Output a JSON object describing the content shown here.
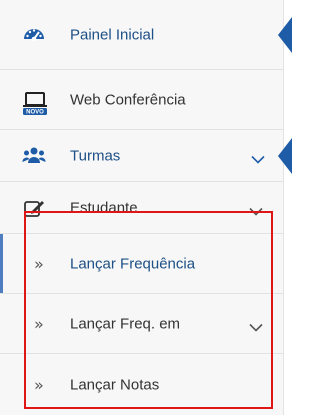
{
  "menu": {
    "painel": {
      "label": "Painel Inicial",
      "icon": "dashboard-icon"
    },
    "web": {
      "label": "Web Conferência",
      "badge": "NOVO",
      "icon": "laptop-icon"
    },
    "turmas": {
      "label": "Turmas",
      "icon": "users-icon"
    },
    "estudante": {
      "label": "Estudante",
      "icon": "edit-icon"
    },
    "lancar_frequencia": {
      "label": "Lançar Frequência",
      "icon": "double-chevron-icon"
    },
    "lancar_freq_em": {
      "label": "Lançar Freq. em",
      "icon": "double-chevron-icon"
    },
    "lancar_notas": {
      "label": "Lançar Notas",
      "icon": "double-chevron-icon"
    }
  },
  "colors": {
    "primary_text": "#1d4f87",
    "icon_blue": "#1e5ca8",
    "highlight_border": "#e01616"
  }
}
